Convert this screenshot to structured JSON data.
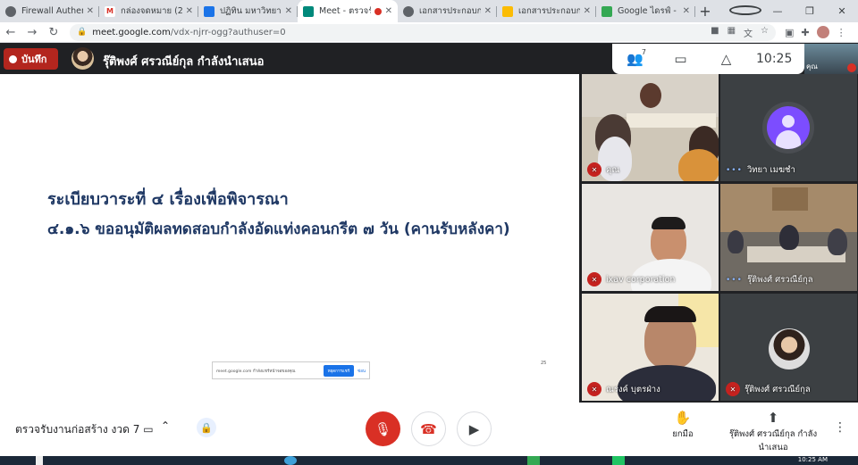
{
  "browser": {
    "tabs": [
      {
        "title": "Firewall Authenticati",
        "favicon_color": "#5f6368"
      },
      {
        "title": "กล่องจดหมาย (2,00",
        "favicon_color": "#d93025",
        "favicon_letter": "M"
      },
      {
        "title": "ปฏิทิน มหาวิทยาลัยฯ",
        "favicon_color": "#1a73e8"
      },
      {
        "title": "Meet - ตรวจรั",
        "favicon_color": "#00897b",
        "active": true
      },
      {
        "title": "เอกสารประกอบการป",
        "favicon_color": "#5f6368"
      },
      {
        "title": "เอกสารประกอบการป",
        "favicon_color": "#fbbc04"
      },
      {
        "title": "Google ไดรฟ์ - ทั้",
        "favicon_color": "#34a853"
      }
    ],
    "url_host": "meet.google.com",
    "url_path": "/vdx-njrr-ogg?authuser=0"
  },
  "meet": {
    "record_label": "บันทึก",
    "presenting_text": "รุ๊ติพงศ์ ศรวณีย์กุล กำลังนำเสนอ",
    "participant_count": "7",
    "clock": "10:25",
    "self_label": "คุณ",
    "slide": {
      "line1": "ระเบียบวาระที่ ๔ เรื่องเพื่อพิจารณา",
      "line2": "๔.๑.๖  ขออนุมัติผลทดสอบกำลังอัดแท่งคอนกรีต ๗ วัน (คานรับหลังคา)",
      "share_bar_text": "meet.google.com กำลังแชร์หน้าจอของคุณ",
      "share_bar_stop": "หยุดการแชร์",
      "share_bar_hide": "ซ่อน",
      "mark": "25"
    },
    "tiles": [
      {
        "name": "คุณ",
        "muted": true
      },
      {
        "name": "วิทยา เมฆชำ",
        "muted": false
      },
      {
        "name": "ixav corporation",
        "muted": true
      },
      {
        "name": "รุ๊ติพงศ์ ศรวณีย์กุล",
        "muted": false
      },
      {
        "name": "ณรงค์ บุตรฝ่าง",
        "muted": true
      },
      {
        "name": "รุ๊ติพงศ์ ศรวณีย์กุล",
        "muted": true
      }
    ],
    "meeting_name": "ตรวจรับงานก่อสร้าง งวด 7",
    "raise_hand_label": "ยกมือ",
    "presenter_label": "รุ๊ติพงศ์ ศรวณีย์กุล กำลังนำเสนอ"
  },
  "taskbar": {
    "time": "10:25 AM"
  }
}
